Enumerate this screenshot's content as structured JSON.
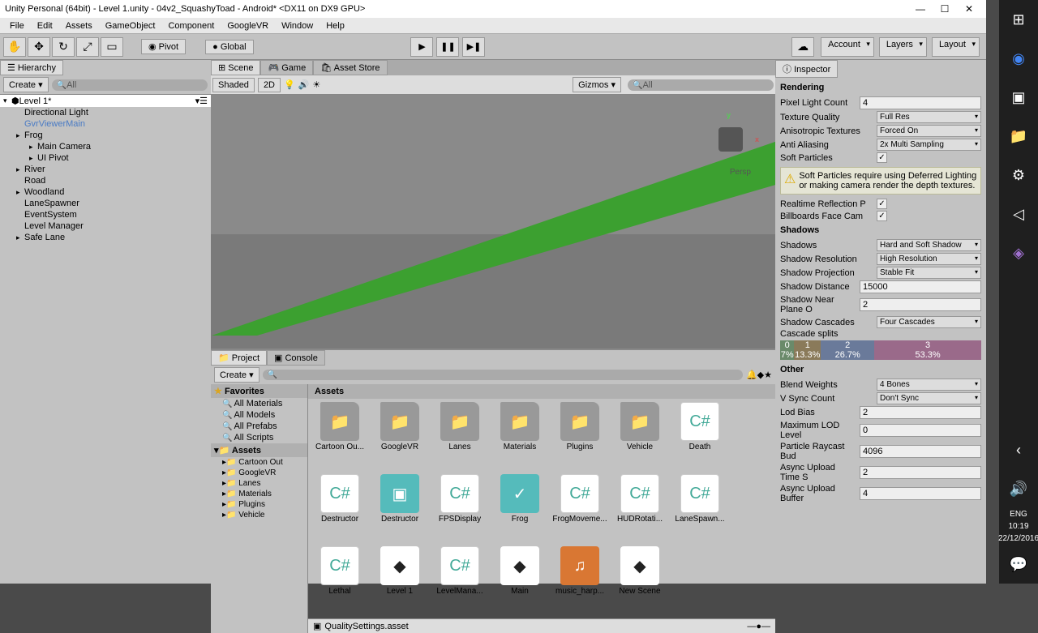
{
  "titlebar": {
    "title": "Unity Personal (64bit) - Level 1.unity - 04v2_SquashyToad - Android* <DX11 on DX9 GPU>"
  },
  "menubar": [
    "File",
    "Edit",
    "Assets",
    "GameObject",
    "Component",
    "GoogleVR",
    "Window",
    "Help"
  ],
  "toolbar": {
    "pivot": "Pivot",
    "global": "Global",
    "account": "Account",
    "layers": "Layers",
    "layout": "Layout"
  },
  "hierarchy": {
    "tab": "Hierarchy",
    "create": "Create",
    "search": "All",
    "root": "Level 1*",
    "items": [
      {
        "label": "Directional Light",
        "indent": 1
      },
      {
        "label": "GvrViewerMain",
        "indent": 1,
        "blue": true
      },
      {
        "label": "Frog",
        "indent": 1,
        "expand": true
      },
      {
        "label": "Main Camera",
        "indent": 2,
        "expand": true
      },
      {
        "label": "UI Pivot",
        "indent": 2,
        "expand": true
      },
      {
        "label": "River",
        "indent": 1,
        "expand": true
      },
      {
        "label": "Road",
        "indent": 1
      },
      {
        "label": "Woodland",
        "indent": 1,
        "expand": true
      },
      {
        "label": "LaneSpawner",
        "indent": 1
      },
      {
        "label": "EventSystem",
        "indent": 1
      },
      {
        "label": "Level Manager",
        "indent": 1
      },
      {
        "label": "Safe Lane",
        "indent": 1,
        "expand": true
      }
    ]
  },
  "scene": {
    "tabs": [
      "Scene",
      "Game",
      "Asset Store"
    ],
    "shaded": "Shaded",
    "twod": "2D",
    "gizmos": "Gizmos",
    "search": "All",
    "persp": "Persp"
  },
  "project": {
    "tabs": [
      "Project",
      "Console"
    ],
    "create": "Create",
    "favorites": "Favorites",
    "fav_items": [
      "All Materials",
      "All Models",
      "All Prefabs",
      "All Scripts"
    ],
    "assets_label": "Assets",
    "tree_items": [
      "Cartoon Out",
      "GoogleVR",
      "Lanes",
      "Materials",
      "Plugins",
      "Vehicle"
    ],
    "breadcrumb": "Assets",
    "items": [
      {
        "label": "Cartoon Ou...",
        "type": "folder"
      },
      {
        "label": "GoogleVR",
        "type": "folder"
      },
      {
        "label": "Lanes",
        "type": "folder"
      },
      {
        "label": "Materials",
        "type": "folder"
      },
      {
        "label": "Plugins",
        "type": "folder"
      },
      {
        "label": "Vehicle",
        "type": "folder"
      },
      {
        "label": "Death",
        "type": "cs"
      },
      {
        "label": "Destructor",
        "type": "cs"
      },
      {
        "label": "Destructor",
        "type": "prefab"
      },
      {
        "label": "FPSDisplay",
        "type": "cs"
      },
      {
        "label": "Frog",
        "type": "prefab-green"
      },
      {
        "label": "FrogMoveme...",
        "type": "cs"
      },
      {
        "label": "HUDRotati...",
        "type": "cs"
      },
      {
        "label": "LaneSpawn...",
        "type": "cs"
      },
      {
        "label": "Lethal",
        "type": "cs"
      },
      {
        "label": "Level 1",
        "type": "unity"
      },
      {
        "label": "LevelMana...",
        "type": "cs"
      },
      {
        "label": "Main",
        "type": "unity"
      },
      {
        "label": "music_harp...",
        "type": "audio"
      },
      {
        "label": "New Scene",
        "type": "unity"
      }
    ],
    "path": "QualitySettings.asset"
  },
  "inspector": {
    "tab": "Inspector",
    "rendering": {
      "title": "Rendering",
      "pixel_light": {
        "label": "Pixel Light Count",
        "value": "4"
      },
      "texture_quality": {
        "label": "Texture Quality",
        "value": "Full Res"
      },
      "aniso": {
        "label": "Anisotropic Textures",
        "value": "Forced On"
      },
      "aa": {
        "label": "Anti Aliasing",
        "value": "2x Multi Sampling"
      },
      "soft_particles": {
        "label": "Soft Particles"
      },
      "warning": "Soft Particles require using Deferred Lighting or making camera render the depth textures.",
      "realtime_refl": {
        "label": "Realtime Reflection P"
      },
      "billboards": {
        "label": "Billboards Face Cam"
      }
    },
    "shadows": {
      "title": "Shadows",
      "shadows": {
        "label": "Shadows",
        "value": "Hard and Soft Shadow"
      },
      "resolution": {
        "label": "Shadow Resolution",
        "value": "High Resolution"
      },
      "projection": {
        "label": "Shadow Projection",
        "value": "Stable Fit"
      },
      "distance": {
        "label": "Shadow Distance",
        "value": "15000"
      },
      "near_plane": {
        "label": "Shadow Near Plane O",
        "value": "2"
      },
      "cascades": {
        "label": "Shadow Cascades",
        "value": "Four Cascades"
      },
      "splits_label": "Cascade splits",
      "splits": [
        {
          "idx": "0",
          "val": "7%",
          "color": "#6a8a6a"
        },
        {
          "idx": "1",
          "val": "13.3%",
          "color": "#8a7a5a"
        },
        {
          "idx": "2",
          "val": "26.7%",
          "color": "#6a7a9a"
        },
        {
          "idx": "3",
          "val": "53.3%",
          "color": "#9a6a8a"
        }
      ]
    },
    "other": {
      "title": "Other",
      "blend_weights": {
        "label": "Blend Weights",
        "value": "4 Bones"
      },
      "vsync": {
        "label": "V Sync Count",
        "value": "Don't Sync"
      },
      "lod_bias": {
        "label": "Lod Bias",
        "value": "2"
      },
      "max_lod": {
        "label": "Maximum LOD Level",
        "value": "0"
      },
      "raycast": {
        "label": "Particle Raycast Bud",
        "value": "4096"
      },
      "async_time": {
        "label": "Async Upload Time S",
        "value": "2"
      },
      "async_buffer": {
        "label": "Async Upload Buffer",
        "value": "4"
      }
    }
  },
  "systray": {
    "lang": "ENG",
    "time": "10:19",
    "date": "22/12/2016"
  }
}
